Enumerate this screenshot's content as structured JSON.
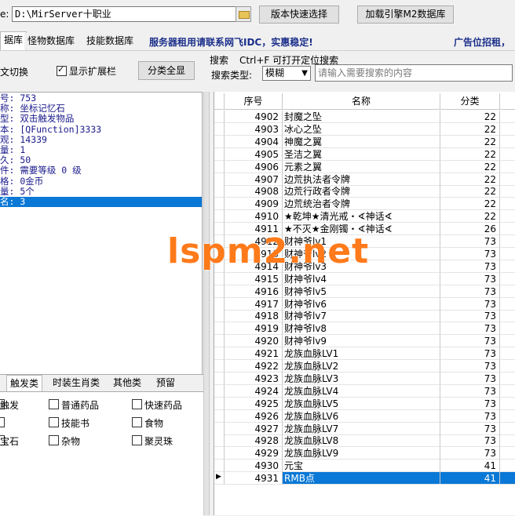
{
  "topbar": {
    "path_label": "e:",
    "path_value": "D:\\MirServer十职业",
    "version_button": "版本快速选择",
    "load_button": "加载引擎M2数据库"
  },
  "tabs": [
    {
      "label": "据库",
      "active": true
    },
    {
      "label": "怪物数据库",
      "active": false
    },
    {
      "label": "技能数据库",
      "active": false
    }
  ],
  "ad_text": "服务器租用请联系网飞IDC，实惠稳定!",
  "ad_right": "广告位招租，",
  "options": {
    "toggle_label": "文切换",
    "show_ext_label": "显示扩展栏",
    "show_ext_checked": true,
    "classify_button": "分类全显"
  },
  "search": {
    "title": "搜索",
    "hint": "Ctrl+F 可打开定位搜索",
    "type_label": "搜索类型:",
    "mode_value": "模糊",
    "placeholder": "请输入需要搜索的内容"
  },
  "info_lines": [
    {
      "text": "号: 753",
      "selected": false
    },
    {
      "text": "称: 坐标记忆石",
      "selected": false
    },
    {
      "text": "型: 双击触发物品",
      "selected": false
    },
    {
      "text": "本: [QFunction]3333",
      "selected": false
    },
    {
      "text": "观: 14339",
      "selected": false
    },
    {
      "text": "量: 1",
      "selected": false
    },
    {
      "text": "久: 50",
      "selected": false
    },
    {
      "text": "件: 需要等级 0 级",
      "selected": false
    },
    {
      "text": "格: 0金币",
      "selected": false
    },
    {
      "text": "量: 5个",
      "selected": false
    },
    {
      "text": "名: 3",
      "selected": true
    }
  ],
  "category_tabs": [
    {
      "label": "触发类",
      "active": true
    },
    {
      "label": "时装生肖类",
      "active": false
    },
    {
      "label": "其他类",
      "active": false
    },
    {
      "label": "预留",
      "active": false
    }
  ],
  "category_options": {
    "col1": [
      "触发",
      "",
      "宝石"
    ],
    "col2": [
      "普通药品",
      "技能书",
      "杂物"
    ],
    "col3": [
      "快速药品",
      "食物",
      "聚灵珠"
    ]
  },
  "grid": {
    "headers": [
      "序号",
      "名称",
      "分类"
    ],
    "rows": [
      {
        "id": "4902",
        "name": "封魔之坠",
        "cat": "22"
      },
      {
        "id": "4903",
        "name": "冰心之坠",
        "cat": "22"
      },
      {
        "id": "4904",
        "name": "神魔之翼",
        "cat": "22"
      },
      {
        "id": "4905",
        "name": "圣洁之翼",
        "cat": "22"
      },
      {
        "id": "4906",
        "name": "元素之翼",
        "cat": "22"
      },
      {
        "id": "4907",
        "name": "边荒执法者令牌",
        "cat": "22"
      },
      {
        "id": "4908",
        "name": "边荒行政者令牌",
        "cat": "22"
      },
      {
        "id": "4909",
        "name": "边荒统治者令牌",
        "cat": "22"
      },
      {
        "id": "4910",
        "name": "★乾坤★清光戒・∢神话∢",
        "cat": "22"
      },
      {
        "id": "4911",
        "name": "★不灭★金刚镯・∢神话∢",
        "cat": "26"
      },
      {
        "id": "4912",
        "name": "财神爷lv1",
        "cat": "73"
      },
      {
        "id": "4913",
        "name": "财神爷lv2",
        "cat": "73"
      },
      {
        "id": "4914",
        "name": "财神爷lv3",
        "cat": "73"
      },
      {
        "id": "4915",
        "name": "财神爷lv4",
        "cat": "73"
      },
      {
        "id": "4916",
        "name": "财神爷lv5",
        "cat": "73"
      },
      {
        "id": "4917",
        "name": "财神爷lv6",
        "cat": "73"
      },
      {
        "id": "4918",
        "name": "财神爷lv7",
        "cat": "73"
      },
      {
        "id": "4919",
        "name": "财神爷lv8",
        "cat": "73"
      },
      {
        "id": "4920",
        "name": "财神爷lv9",
        "cat": "73"
      },
      {
        "id": "4921",
        "name": "龙族血脉LV1",
        "cat": "73"
      },
      {
        "id": "4922",
        "name": "龙族血脉LV2",
        "cat": "73"
      },
      {
        "id": "4923",
        "name": "龙族血脉LV3",
        "cat": "73"
      },
      {
        "id": "4924",
        "name": "龙族血脉LV4",
        "cat": "73"
      },
      {
        "id": "4925",
        "name": "龙族血脉LV5",
        "cat": "73"
      },
      {
        "id": "4926",
        "name": "龙族血脉LV6",
        "cat": "73"
      },
      {
        "id": "4927",
        "name": "龙族血脉LV7",
        "cat": "73"
      },
      {
        "id": "4928",
        "name": "龙族血脉LV8",
        "cat": "73"
      },
      {
        "id": "4929",
        "name": "龙族血脉LV9",
        "cat": "73"
      },
      {
        "id": "4930",
        "name": "元宝",
        "cat": "41"
      },
      {
        "id": "4931",
        "name": "RMB点",
        "cat": "41",
        "selected": true
      }
    ]
  },
  "watermark": "lspm2.net",
  "colors": {
    "selection": "#0a78d6",
    "info_text": "#1a1a8c",
    "ad_text": "#1b2f8a",
    "watermark": "#ff7a1a"
  }
}
